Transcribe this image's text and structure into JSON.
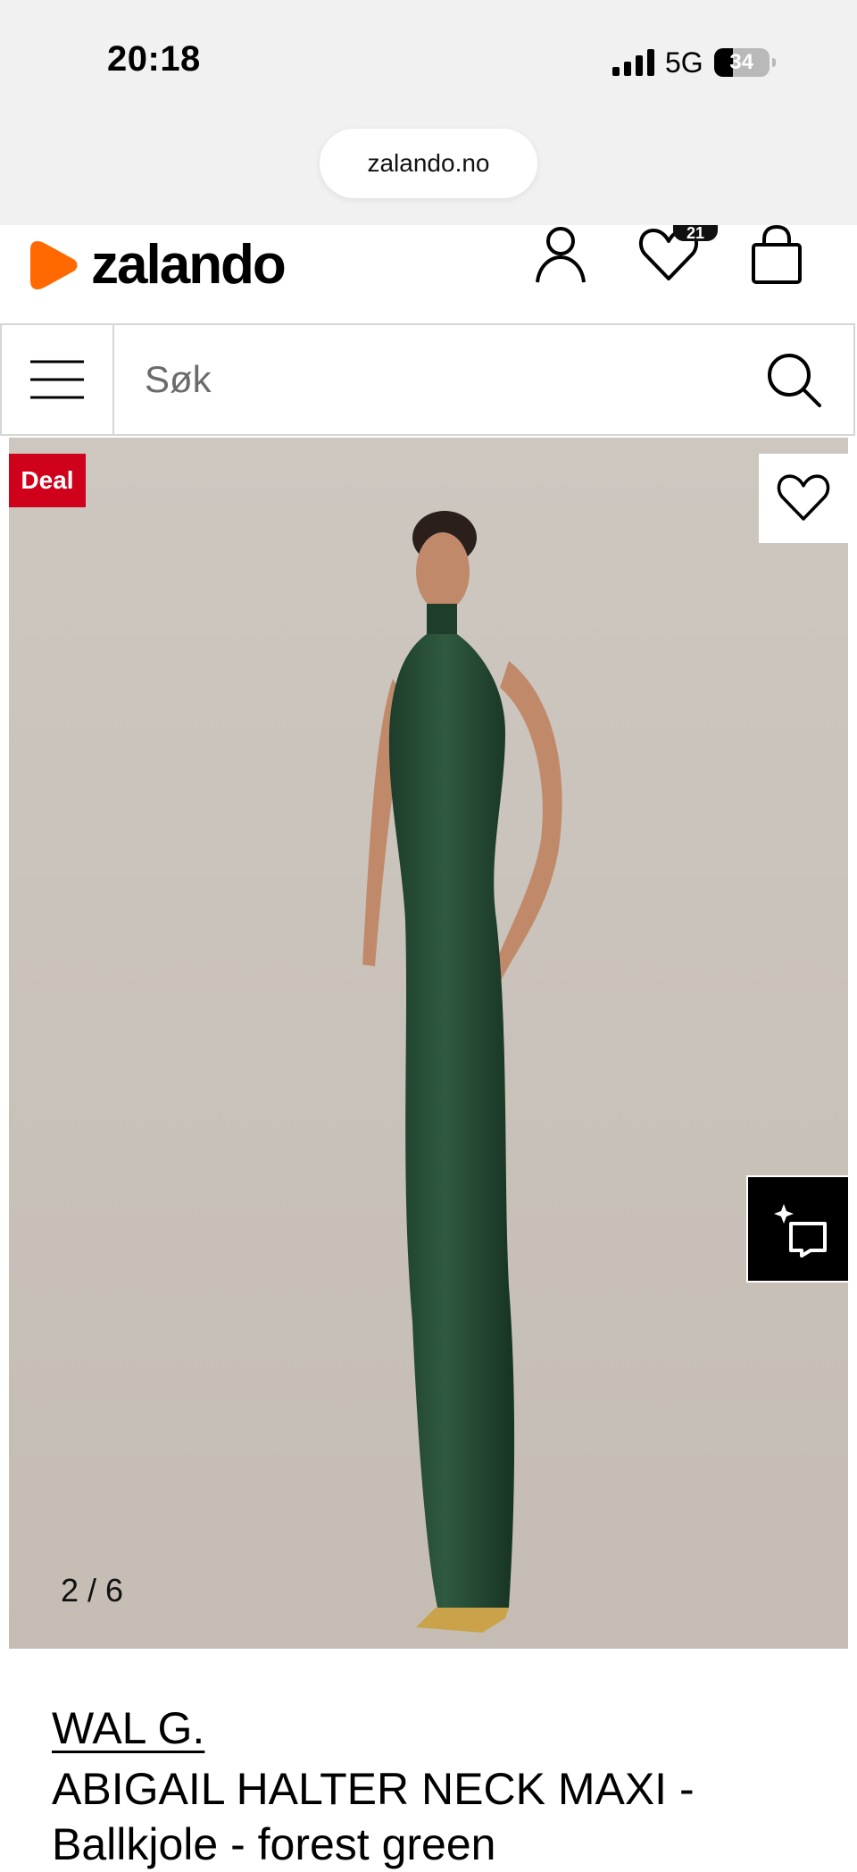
{
  "status_bar": {
    "time": "20:18",
    "network": "5G",
    "battery": "34"
  },
  "browser": {
    "url": "zalando.no"
  },
  "header": {
    "logo_text": "zalando",
    "wishlist_count": "21",
    "brand_color": "#ff6900"
  },
  "search": {
    "placeholder": "Søk"
  },
  "product_image": {
    "deal_label": "Deal",
    "deal_color": "#d0021b",
    "counter": "2 / 6"
  },
  "product": {
    "brand": "WAL G.",
    "name": "ABIGAIL HALTER NECK MAXI - Ballkjole - forest green"
  }
}
